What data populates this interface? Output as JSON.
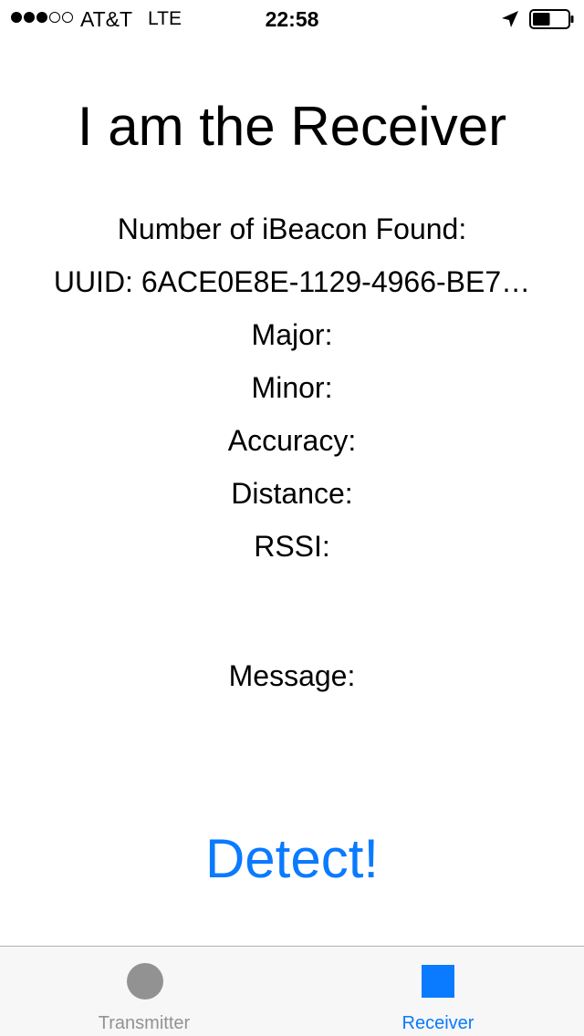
{
  "status_bar": {
    "signal_bars_filled": 3,
    "signal_bars_total": 5,
    "carrier": "AT&T",
    "network": "LTE",
    "time": "22:58",
    "location_icon": "location-arrow-icon",
    "battery_icon": "battery-icon",
    "battery_level": 0.5
  },
  "main": {
    "title": "I am the Receiver",
    "beacon_count_label": "Number of iBeacon Found:",
    "uuid_label": "UUID: 6ACE0E8E-1129-4966-BE7…",
    "major_label": "Major:",
    "minor_label": "Minor:",
    "accuracy_label": "Accuracy:",
    "distance_label": "Distance:",
    "rssi_label": "RSSI:",
    "message_label": "Message:",
    "detect_button": "Detect!"
  },
  "tab_bar": {
    "tabs": [
      {
        "label": "Transmitter",
        "icon": "circle-icon",
        "selected": false
      },
      {
        "label": "Receiver",
        "icon": "square-icon",
        "selected": true
      }
    ]
  },
  "colors": {
    "accent": "#0a7aff",
    "inactive": "#929292",
    "tab_bar_background": "#f7f7f7"
  }
}
